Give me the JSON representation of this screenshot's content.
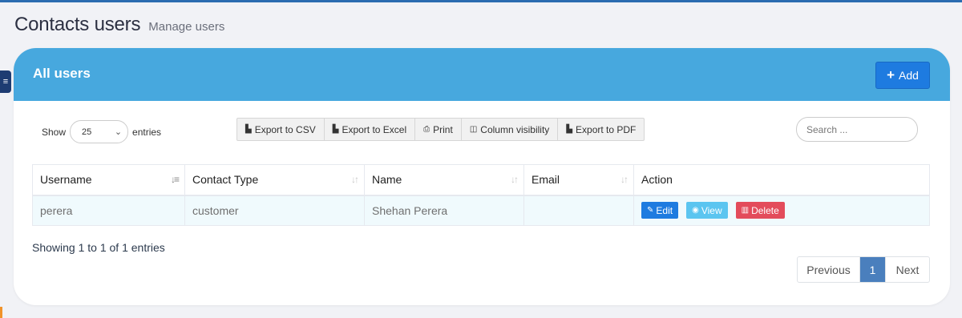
{
  "header": {
    "title": "Contacts users",
    "subtitle": "Manage users"
  },
  "card": {
    "title": "All users",
    "add_label": "Add"
  },
  "length": {
    "show_label": "Show",
    "value": "25",
    "entries_label": "entries"
  },
  "export_buttons": [
    {
      "label": "Export to CSV",
      "icon": "csv-file-icon"
    },
    {
      "label": "Export to Excel",
      "icon": "excel-file-icon"
    },
    {
      "label": "Print",
      "icon": "print-icon"
    },
    {
      "label": "Column visibility",
      "icon": "columns-icon"
    },
    {
      "label": "Export to PDF",
      "icon": "pdf-file-icon"
    }
  ],
  "search": {
    "placeholder": "Search ..."
  },
  "table": {
    "columns": [
      "Username",
      "Contact Type",
      "Name",
      "Email",
      "Action"
    ],
    "rows": [
      {
        "username": "perera",
        "contact_type": "customer",
        "name": "Shehan Perera",
        "email": ""
      }
    ],
    "actions": {
      "edit": "Edit",
      "view": "View",
      "delete": "Delete"
    }
  },
  "info": "Showing 1 to 1 of 1 entries",
  "pagination": {
    "previous": "Previous",
    "current": "1",
    "next": "Next"
  },
  "colors": {
    "card_header": "#47a8de",
    "primary": "#1e7be0",
    "info": "#5bc5f0",
    "danger": "#e34c5b",
    "page_active": "#4a7fbd"
  }
}
